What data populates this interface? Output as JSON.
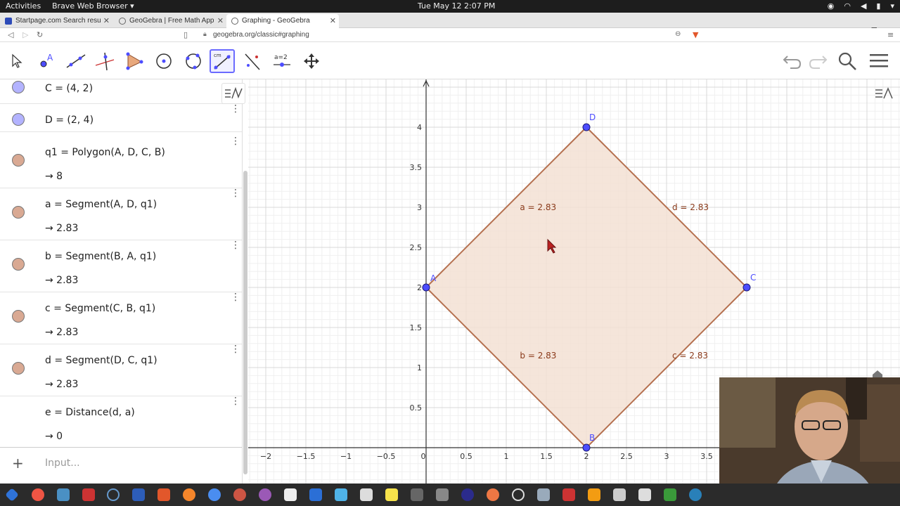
{
  "topbar": {
    "activities": "Activities",
    "app_menu": "Brave Web Browser ▾",
    "clock": "Tue May 12  2:07 PM"
  },
  "browser": {
    "tabs": [
      {
        "label": "Startpage.com Search resu",
        "favicon_color": "#2d4bb8"
      },
      {
        "label": "GeoGebra | Free Math App",
        "favicon_color": "#666666"
      },
      {
        "label": "Graphing - GeoGebra",
        "favicon_color": "#666666"
      }
    ],
    "url": "geogebra.org/classic#graphing"
  },
  "algebra": {
    "rows": [
      {
        "def": "C = (4, 2)",
        "value": "",
        "color": "#b3b3ff"
      },
      {
        "def": "D = (2, 4)",
        "value": "",
        "color": "#b3b3ff"
      },
      {
        "def": "q1 = Polygon(A, D, C, B)",
        "value": "→  8",
        "color": "#d9a993"
      },
      {
        "def": "a = Segment(A, D, q1)",
        "value": "→  2.83",
        "color": "#d9a993"
      },
      {
        "def": "b = Segment(B, A, q1)",
        "value": "→  2.83",
        "color": "#d9a993"
      },
      {
        "def": "c = Segment(C, B, q1)",
        "value": "→  2.83",
        "color": "#d9a993"
      },
      {
        "def": "d = Segment(D, C, q1)",
        "value": "→  2.83",
        "color": "#d9a993"
      },
      {
        "def": "e = Distance(d, a)",
        "value": "→  0",
        "color": ""
      }
    ],
    "input_placeholder": "Input..."
  },
  "graphics": {
    "x_ticks": [
      "−2",
      "−1.5",
      "−1",
      "−0.5",
      "0",
      "0.5",
      "1",
      "1.5",
      "2",
      "2.5",
      "3",
      "3.5"
    ],
    "y_ticks": [
      "0.5",
      "1",
      "1.5",
      "2",
      "2.5",
      "3",
      "3.5",
      "4"
    ],
    "points": [
      {
        "name": "A",
        "x": 0,
        "y": 2
      },
      {
        "name": "B",
        "x": 2,
        "y": 0
      },
      {
        "name": "C",
        "x": 4,
        "y": 2
      },
      {
        "name": "D",
        "x": 2,
        "y": 4
      }
    ],
    "segment_labels": [
      "a = 2.83",
      "d = 2.83",
      "b = 2.83",
      "c = 2.83"
    ],
    "polygon_fill": "#f3e0d4",
    "polygon_stroke": "#b5704f",
    "point_color": "#4d4dff"
  }
}
